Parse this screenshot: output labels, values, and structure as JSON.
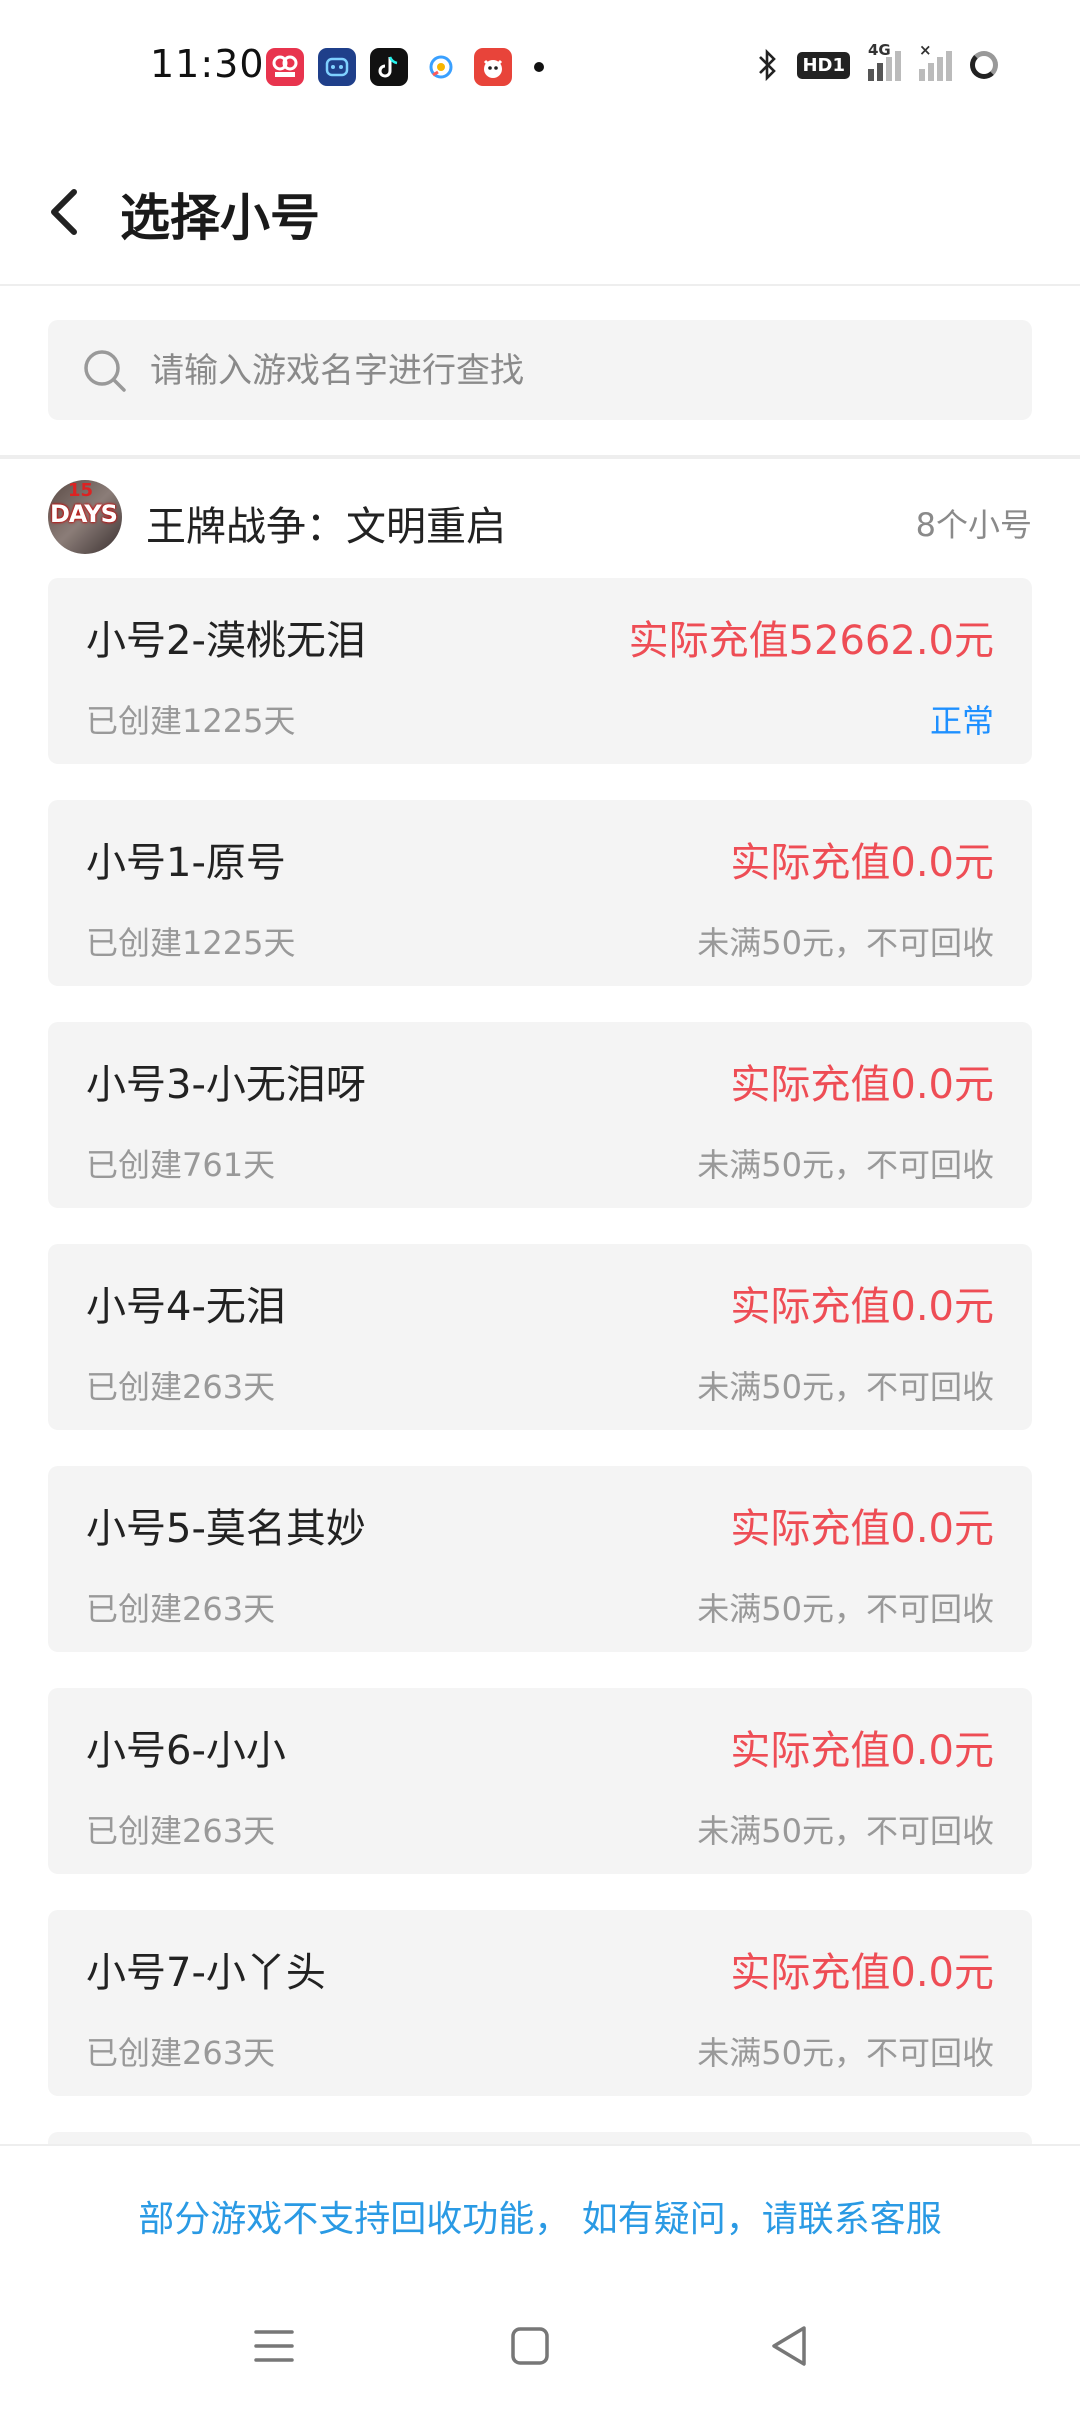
{
  "status_bar": {
    "time": "11:30",
    "apps": [
      {
        "icon": "video-app-icon",
        "color": "#e8344e"
      },
      {
        "icon": "robot-app-icon",
        "color": "#1f3f8a"
      },
      {
        "icon": "tiktok-icon",
        "color": "#111111"
      },
      {
        "icon": "browser-app-icon",
        "color": "#ffffff"
      },
      {
        "icon": "mascot-app-icon",
        "color": "#e8443a"
      }
    ],
    "hd_label": "HD1",
    "network_label": "4G"
  },
  "header": {
    "title": "选择小号"
  },
  "search": {
    "placeholder": "请输入游戏名字进行查找"
  },
  "game": {
    "name": "王牌战争：文明重启",
    "count": "8个小号",
    "avatar_text": "DAYS",
    "avatar_num": "15"
  },
  "accounts": [
    {
      "name": "小号2-漠桃无泪",
      "amount": "实际充值52662.0元",
      "created": "已创建1225天",
      "status": "正常",
      "normal": true
    },
    {
      "name": "小号1-原号",
      "amount": "实际充值0.0元",
      "created": "已创建1225天",
      "status": "未满50元，不可回收",
      "normal": false
    },
    {
      "name": "小号3-小无泪呀",
      "amount": "实际充值0.0元",
      "created": "已创建761天",
      "status": "未满50元，不可回收",
      "normal": false
    },
    {
      "name": "小号4-无泪",
      "amount": "实际充值0.0元",
      "created": "已创建263天",
      "status": "未满50元，不可回收",
      "normal": false
    },
    {
      "name": "小号5-莫名其妙",
      "amount": "实际充值0.0元",
      "created": "已创建263天",
      "status": "未满50元，不可回收",
      "normal": false
    },
    {
      "name": "小号6-小小",
      "amount": "实际充值0.0元",
      "created": "已创建263天",
      "status": "未满50元，不可回收",
      "normal": false
    },
    {
      "name": "小号7-小丫头",
      "amount": "实际充值0.0元",
      "created": "已创建263天",
      "status": "未满50元，不可回收",
      "normal": false
    }
  ],
  "footer": {
    "notice": "部分游戏不支持回收功能， 如有疑问，请联系客服"
  },
  "colors": {
    "amount": "#ee4d55",
    "status_normal": "#1e90ff",
    "notice": "#2a9ae4",
    "card_bg": "#f4f4f4"
  }
}
